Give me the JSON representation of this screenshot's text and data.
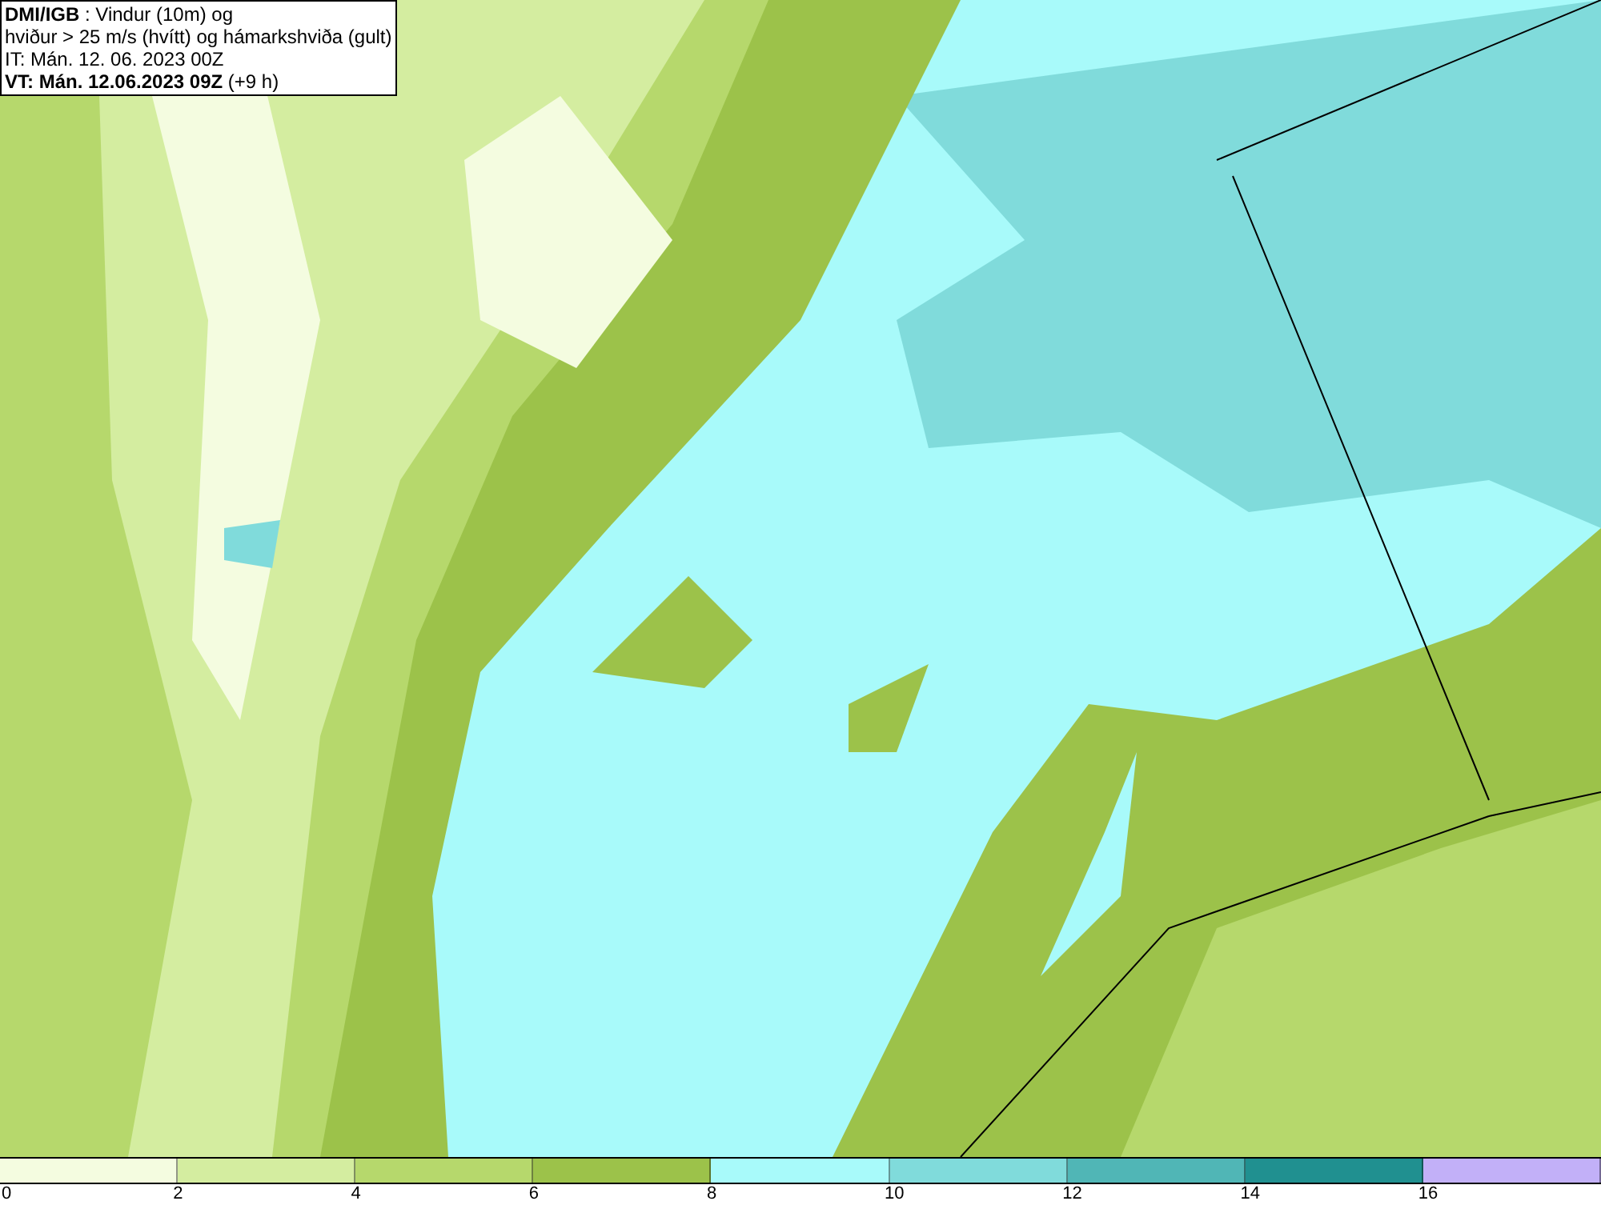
{
  "header": {
    "lines": [
      "**DMI/IGB** : Vindur (10m) og",
      "hviður > 25 m/s (hvítt) og hámarkshviða (gult)",
      "IT: Mán. 12. 06. 2023 00Z",
      "**VT: Mán. 12.06.2023 09Z** (+9 h)"
    ]
  },
  "legend": [
    {
      "color": "#f4fce0",
      "label": "0"
    },
    {
      "color": "#d4eda0",
      "label": "2"
    },
    {
      "color": "#b6d86c",
      "label": "4"
    },
    {
      "color": "#9cc24a",
      "label": "6"
    },
    {
      "color": "#a8fafa",
      "label": "8"
    },
    {
      "color": "#80dbdb",
      "label": "10"
    },
    {
      "color": "#50b6b6",
      "label": "12"
    },
    {
      "color": "#209090",
      "label": "14"
    },
    {
      "color": "#c2b0f8",
      "label": "16"
    }
  ]
}
